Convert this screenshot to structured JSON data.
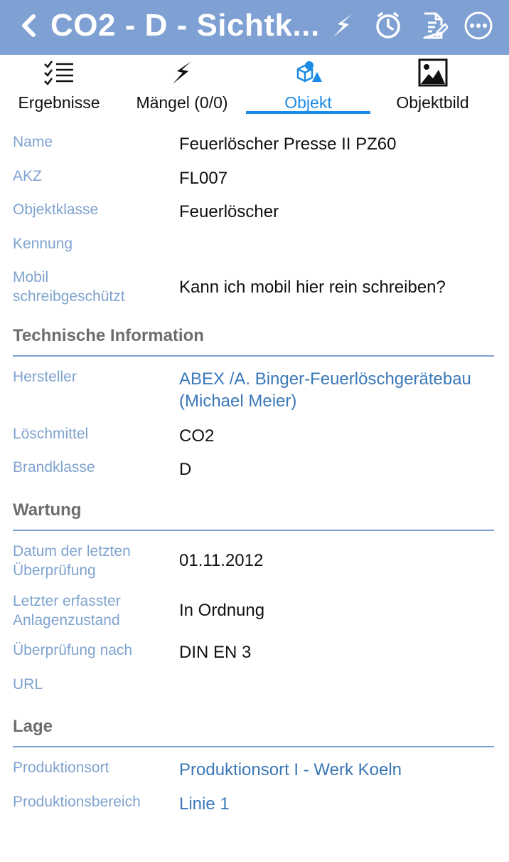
{
  "header": {
    "title": "CO2 - D - Sichtk...",
    "back_icon": "chevron-left-icon",
    "actions": [
      "lightning-icon",
      "clock-icon",
      "edit-document-icon",
      "more-icon"
    ]
  },
  "tabs": [
    {
      "label": "Ergebnisse",
      "icon": "checklist-icon"
    },
    {
      "label": "Mängel (0/0)",
      "icon": "lightning-icon"
    },
    {
      "label": "Objekt",
      "icon": "objects-icon",
      "active": true
    },
    {
      "label": "Objektbild",
      "icon": "image-icon"
    }
  ],
  "fields": {
    "name": {
      "label": "Name",
      "value": "Feuerlöscher Presse  II PZ60"
    },
    "akz": {
      "label": "AKZ",
      "value": "FL007"
    },
    "objektklasse": {
      "label": "Objektklasse",
      "value": "Feuerlöscher"
    },
    "kennung": {
      "label": "Kennung",
      "value": ""
    },
    "mobil": {
      "label": "Mobil schreibgeschützt",
      "value": "Kann ich mobil hier rein schreiben?"
    }
  },
  "sections": {
    "technisch": {
      "title": "Technische Information",
      "hersteller": {
        "label": "Hersteller",
        "value": "ABEX /A. Binger-Feuerlöschgerätebau (Michael Meier)"
      },
      "loeschmittel": {
        "label": "Löschmittel",
        "value": "CO2"
      },
      "brandklasse": {
        "label": "Brandklasse",
        "value": "D"
      }
    },
    "wartung": {
      "title": "Wartung",
      "datum": {
        "label": "Datum der letzten Überprüfung",
        "value": "01.11.2012"
      },
      "zustand": {
        "label": "Letzter erfasster Anlagenzustand",
        "value": "In Ordnung"
      },
      "pruefung": {
        "label": "Überprüfung nach",
        "value": "DIN EN 3"
      },
      "url": {
        "label": "URL",
        "value": ""
      }
    },
    "lage": {
      "title": "Lage",
      "ort": {
        "label": "Produktionsort",
        "value": "Produktionsort I - Werk Koeln"
      },
      "bereich": {
        "label": "Produktionsbereich",
        "value": "Linie 1"
      }
    }
  },
  "colors": {
    "header_bg": "#7ea0d2",
    "label": "#7fa3cf",
    "link": "#3a78b8",
    "active_tab": "#1a8be6",
    "section_title": "#6d6d6d"
  }
}
